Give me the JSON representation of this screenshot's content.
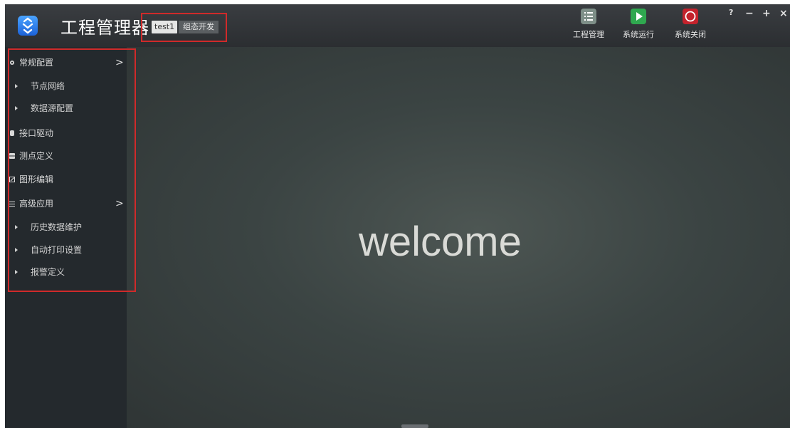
{
  "titlebar": {
    "title": "工程管理器",
    "project_name": "test1",
    "mode": "组态开发"
  },
  "toolbar": {
    "project_manage": "工程管理",
    "system_run": "系统运行",
    "system_close": "系统关闭"
  },
  "window_controls": {
    "help": "?",
    "minimize": "−",
    "maximize": "+",
    "close": "×"
  },
  "sidebar": {
    "items": [
      {
        "label": "常规配置",
        "icon": "gear-icon",
        "has_arrow": true
      },
      {
        "label": "节点网络",
        "sub": true
      },
      {
        "label": "数据源配置",
        "sub": true
      },
      {
        "label": "接口驱动",
        "icon": "cylinder-icon"
      },
      {
        "label": "测点定义",
        "icon": "database-icon"
      },
      {
        "label": "图形编辑",
        "icon": "edit-icon"
      },
      {
        "label": "高级应用",
        "icon": "sliders-icon",
        "has_arrow": true
      },
      {
        "label": "历史数据维护",
        "sub": true
      },
      {
        "label": "自动打印设置",
        "sub": true
      },
      {
        "label": "报警定义",
        "sub": true
      }
    ],
    "chevron": ">"
  },
  "main": {
    "welcome": "welcome"
  },
  "colors": {
    "accent_red": "#d02a2a",
    "run_green": "#2fa84f",
    "close_red": "#c4222c",
    "manage_gray": "#7e8f88"
  }
}
